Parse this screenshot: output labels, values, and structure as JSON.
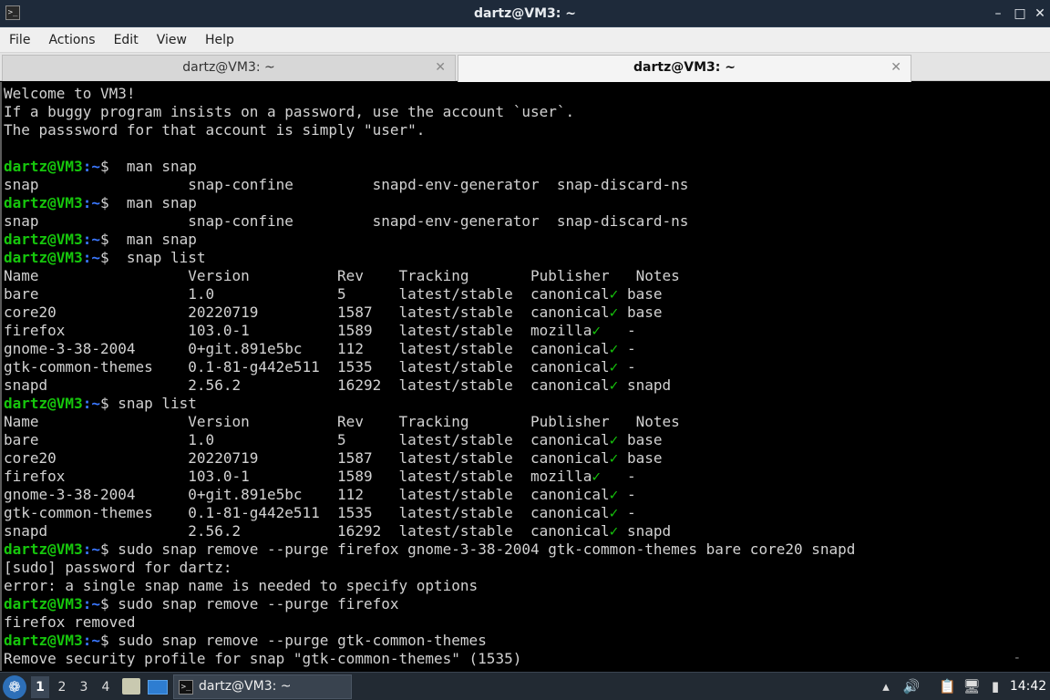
{
  "window": {
    "title": "dartz@VM3: ~",
    "min_glyph": "–",
    "max_glyph": "□",
    "close_glyph": "✕"
  },
  "menu": [
    "File",
    "Actions",
    "Edit",
    "View",
    "Help"
  ],
  "tabs": [
    {
      "label": "dartz@VM3: ~",
      "active": false
    },
    {
      "label": "dartz@VM3: ~",
      "active": true
    }
  ],
  "tab_close_glyph": "✕",
  "prompt": {
    "user": "dartz@VM3",
    "path": ":~",
    "symbol": "$"
  },
  "terminal_lines": [
    {
      "text": "Welcome to VM3!"
    },
    {
      "text": "If a buggy program insists on a password, use the account `user`."
    },
    {
      "text": "The passsword for that account is simply \"user\"."
    },
    {
      "text": ""
    },
    {
      "prompt": true,
      "text": "  man snap"
    },
    {
      "text": "snap                 snap-confine         snapd-env-generator  snap-discard-ns"
    },
    {
      "prompt": true,
      "text": "  man snap"
    },
    {
      "text": "snap                 snap-confine         snapd-env-generator  snap-discard-ns"
    },
    {
      "prompt": true,
      "text": "  man snap"
    },
    {
      "prompt": true,
      "text": "  snap list"
    },
    {
      "text": "Name                 Version          Rev    Tracking       Publisher   Notes"
    },
    {
      "text": "bare                 1.0              5      latest/stable  canonical",
      "check": true,
      "tail": " base"
    },
    {
      "text": "core20               20220719         1587   latest/stable  canonical",
      "check": true,
      "tail": " base"
    },
    {
      "text": "firefox              103.0-1          1589   latest/stable  mozilla",
      "check": true,
      "tail": "   -"
    },
    {
      "text": "gnome-3-38-2004      0+git.891e5bc    112    latest/stable  canonical",
      "check": true,
      "tail": " -"
    },
    {
      "text": "gtk-common-themes    0.1-81-g442e511  1535   latest/stable  canonical",
      "check": true,
      "tail": " -"
    },
    {
      "text": "snapd                2.56.2           16292  latest/stable  canonical",
      "check": true,
      "tail": " snapd"
    },
    {
      "prompt": true,
      "text": " snap list"
    },
    {
      "text": "Name                 Version          Rev    Tracking       Publisher   Notes"
    },
    {
      "text": "bare                 1.0              5      latest/stable  canonical",
      "check": true,
      "tail": " base"
    },
    {
      "text": "core20               20220719         1587   latest/stable  canonical",
      "check": true,
      "tail": " base"
    },
    {
      "text": "firefox              103.0-1          1589   latest/stable  mozilla",
      "check": true,
      "tail": "   -"
    },
    {
      "text": "gnome-3-38-2004      0+git.891e5bc    112    latest/stable  canonical",
      "check": true,
      "tail": " -"
    },
    {
      "text": "gtk-common-themes    0.1-81-g442e511  1535   latest/stable  canonical",
      "check": true,
      "tail": " -"
    },
    {
      "text": "snapd                2.56.2           16292  latest/stable  canonical",
      "check": true,
      "tail": " snapd"
    },
    {
      "prompt": true,
      "text": " sudo snap remove --purge firefox gnome-3-38-2004 gtk-common-themes bare core20 snapd"
    },
    {
      "text": "[sudo] password for dartz:"
    },
    {
      "text": "error: a single snap name is needed to specify options"
    },
    {
      "prompt": true,
      "text": " sudo snap remove --purge firefox"
    },
    {
      "text": "firefox removed"
    },
    {
      "prompt": true,
      "text": " sudo snap remove --purge gtk-common-themes"
    },
    {
      "text": "Remove security profile for snap \"gtk-common-themes\" (1535)"
    }
  ],
  "check_glyph": "✓",
  "scroll_indicator": "-",
  "taskbar": {
    "start_glyph": "❁",
    "workspaces": [
      "1",
      "2",
      "3",
      "4"
    ],
    "active_workspace": "1",
    "task_icon_glyph": ">_",
    "task_label": "dartz@VM3: ~",
    "tray_up_glyph": "▴",
    "tray_volume_glyph": "🔊",
    "tray_clipboard_glyph": "📋",
    "tray_network_glyph": "🖥",
    "tray_battery_glyph": "▮",
    "clock": "14:42"
  }
}
